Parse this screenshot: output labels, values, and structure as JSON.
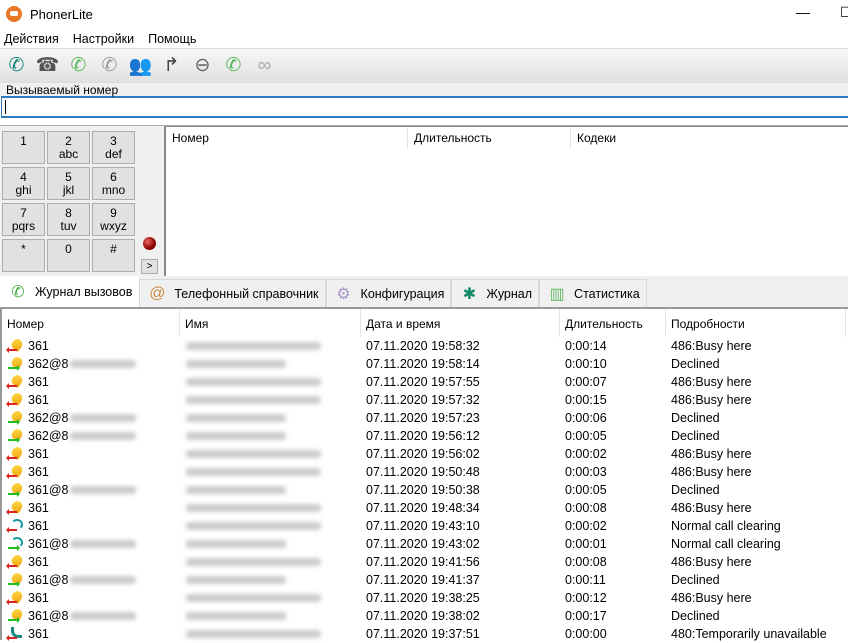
{
  "window": {
    "title": "PhonerLite",
    "minimize": "—",
    "maximize": "☐"
  },
  "menu": [
    "Действия",
    "Настройки",
    "Помощь"
  ],
  "toolbar": [
    {
      "icon": "phone-call-icon",
      "glyph": "✆",
      "color": "#12867a"
    },
    {
      "icon": "hangup-icon",
      "glyph": "☎",
      "color": "#555"
    },
    {
      "icon": "callback-icon",
      "glyph": "✆",
      "color": "#5ab75a"
    },
    {
      "icon": "hold-icon",
      "glyph": "✆",
      "color": "#999"
    },
    {
      "icon": "conference-icon",
      "glyph": "👥",
      "color": "#aaa"
    },
    {
      "icon": "forward-icon",
      "glyph": "↱",
      "color": "#444"
    },
    {
      "icon": "block-icon",
      "glyph": "⊖",
      "color": "#666"
    },
    {
      "icon": "call-wait-icon",
      "glyph": "✆",
      "color": "#5ab75a"
    },
    {
      "icon": "anonymous-icon",
      "glyph": "∞",
      "color": "#aaa"
    }
  ],
  "dial": {
    "label": "Вызываемый номер",
    "value": ""
  },
  "keypad": [
    [
      "1",
      ""
    ],
    [
      "2",
      "abc"
    ],
    [
      "3",
      "def"
    ],
    [
      "4",
      "ghi"
    ],
    [
      "5",
      "jkl"
    ],
    [
      "6",
      "mno"
    ],
    [
      "7",
      "pqrs"
    ],
    [
      "8",
      "tuv"
    ],
    [
      "9",
      "wxyz"
    ],
    [
      "*",
      ""
    ],
    [
      "0",
      ""
    ],
    [
      "#",
      ""
    ]
  ],
  "keypad_more": ">",
  "active_calls": {
    "columns": [
      "Номер",
      "Длительность",
      "Кодеки"
    ]
  },
  "tabs": [
    {
      "label": "Журнал вызовов",
      "icon": "call-log-icon",
      "active": true
    },
    {
      "label": "Телефонный справочник",
      "icon": "phonebook-icon"
    },
    {
      "label": "Конфигурация",
      "icon": "gear-icon"
    },
    {
      "label": "Журнал",
      "icon": "bug-icon"
    },
    {
      "label": "Статистика",
      "icon": "chart-icon"
    }
  ],
  "log": {
    "columns": [
      "Номер",
      "Имя",
      "Дата и время",
      "Длительность",
      "Подробности"
    ],
    "rows": [
      {
        "type": "bell",
        "dir": "in",
        "number": "361",
        "datetime": "07.11.2020 19:58:32",
        "duration": "0:00:14",
        "details": "486:Busy here"
      },
      {
        "type": "bell",
        "dir": "out",
        "number": "362@8",
        "datetime": "07.11.2020 19:58:14",
        "duration": "0:00:10",
        "details": "Declined"
      },
      {
        "type": "bell",
        "dir": "in",
        "number": "361",
        "datetime": "07.11.2020 19:57:55",
        "duration": "0:00:07",
        "details": "486:Busy here"
      },
      {
        "type": "bell",
        "dir": "in",
        "number": "361",
        "datetime": "07.11.2020 19:57:32",
        "duration": "0:00:15",
        "details": "486:Busy here"
      },
      {
        "type": "bell",
        "dir": "out",
        "number": "362@8",
        "datetime": "07.11.2020 19:57:23",
        "duration": "0:00:06",
        "details": "Declined"
      },
      {
        "type": "bell",
        "dir": "out",
        "number": "362@8",
        "datetime": "07.11.2020 19:56:12",
        "duration": "0:00:05",
        "details": "Declined"
      },
      {
        "type": "bell",
        "dir": "in",
        "number": "361",
        "datetime": "07.11.2020 19:56:02",
        "duration": "0:00:02",
        "details": "486:Busy here"
      },
      {
        "type": "bell",
        "dir": "in",
        "number": "361",
        "datetime": "07.11.2020 19:50:48",
        "duration": "0:00:03",
        "details": "486:Busy here"
      },
      {
        "type": "bell",
        "dir": "out",
        "number": "361@8",
        "datetime": "07.11.2020 19:50:38",
        "duration": "0:00:05",
        "details": "Declined"
      },
      {
        "type": "bell",
        "dir": "in",
        "number": "361",
        "datetime": "07.11.2020 19:48:34",
        "duration": "0:00:08",
        "details": "486:Busy here"
      },
      {
        "type": "ring",
        "dir": "in",
        "number": "361",
        "datetime": "07.11.2020 19:43:10",
        "duration": "0:00:02",
        "details": "Normal call clearing"
      },
      {
        "type": "ring",
        "dir": "out",
        "number": "361@8",
        "datetime": "07.11.2020 19:43:02",
        "duration": "0:00:01",
        "details": "Normal call clearing"
      },
      {
        "type": "bell",
        "dir": "in",
        "number": "361",
        "datetime": "07.11.2020 19:41:56",
        "duration": "0:00:08",
        "details": "486:Busy here"
      },
      {
        "type": "bell",
        "dir": "out",
        "number": "361@8",
        "datetime": "07.11.2020 19:41:37",
        "duration": "0:00:11",
        "details": "Declined"
      },
      {
        "type": "bell",
        "dir": "in",
        "number": "361",
        "datetime": "07.11.2020 19:38:25",
        "duration": "0:00:12",
        "details": "486:Busy here"
      },
      {
        "type": "bell",
        "dir": "out",
        "number": "361@8",
        "datetime": "07.11.2020 19:38:02",
        "duration": "0:00:17",
        "details": "Declined"
      },
      {
        "type": "phone",
        "dir": "in",
        "number": "361",
        "datetime": "07.11.2020 19:37:51",
        "duration": "0:00:00",
        "details": "480:Temporarily unavailable"
      }
    ]
  }
}
